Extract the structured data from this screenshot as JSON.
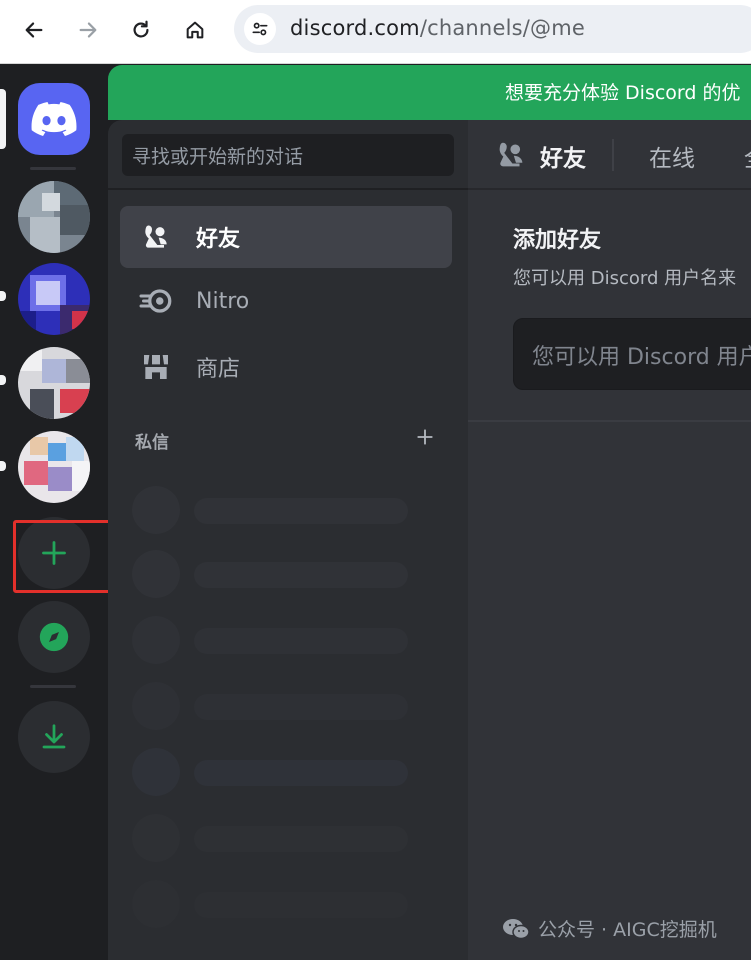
{
  "browser": {
    "url_domain": "discord.com",
    "url_path": "/channels/@me"
  },
  "banner": {
    "text": "想要充分体验 Discord 的优",
    "color": "#23a55a"
  },
  "dm_sidebar": {
    "search_placeholder": "寻找或开始新的对话",
    "nav": [
      {
        "label": "好友",
        "icon": "friends-icon"
      },
      {
        "label": "Nitro",
        "icon": "nitro-icon"
      },
      {
        "label": "商店",
        "icon": "shop-icon"
      }
    ],
    "dm_section_title": "私信"
  },
  "main": {
    "header_title": "好友",
    "tabs": [
      {
        "label": "在线"
      },
      {
        "label": "全"
      }
    ],
    "add_friend": {
      "title": "添加好友",
      "description": "您可以用 Discord 用户名来",
      "input_placeholder": "您可以用 Discord 用户名"
    }
  },
  "rail": {
    "icons": [
      "discord-home-icon",
      "add-server-icon",
      "explore-icon",
      "download-icon"
    ],
    "accent": "#5865f2",
    "green": "#23a55a"
  },
  "watermark": {
    "text": "公众号 · AIGC挖掘机"
  }
}
